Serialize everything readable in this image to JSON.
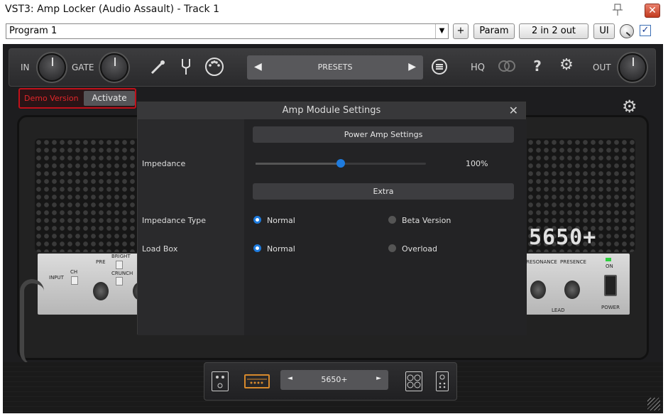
{
  "window": {
    "title": "VST3: Amp Locker (Audio Assault) - Track 1",
    "close_glyph": "✕"
  },
  "toolbar": {
    "program": "Program 1",
    "plus": "+",
    "param": "Param",
    "io": "2 in 2 out",
    "ui": "UI",
    "checked": "✓"
  },
  "plugin": {
    "in_label": "IN",
    "gate_label": "GATE",
    "presets_label": "PRESETS",
    "hq_label": "HQ",
    "help_glyph": "?",
    "out_label": "OUT",
    "demo_label": "Demo Version",
    "activate_label": "Activate"
  },
  "amp": {
    "logo": "5650+",
    "left_panel": [
      "INPUT",
      "CH",
      "PRE",
      "BRIGHT",
      "CRUNCH"
    ],
    "right_panel": [
      "RESONANCE",
      "PRESENCE",
      "ON",
      "LEAD",
      "POWER"
    ]
  },
  "modal": {
    "title": "Amp Module Settings",
    "close_glyph": "✕",
    "section_power": "Power Amp Settings",
    "impedance_label": "Impedance",
    "impedance_value": "100%",
    "impedance_level": 0.5,
    "section_extra": "Extra",
    "impedance_type_label": "Impedance Type",
    "impedance_type_options": [
      "Normal",
      "Beta Version"
    ],
    "impedance_type_selected": "Normal",
    "load_box_label": "Load Box",
    "load_box_options": [
      "Normal",
      "Overload"
    ],
    "load_box_selected": "Normal"
  },
  "bottom": {
    "amp_model": "5650+",
    "prev": "◄",
    "next": "►"
  },
  "colors": {
    "accent": "#1e7bde",
    "demo_red": "#e2262a",
    "cab_orange": "#d7892c"
  }
}
